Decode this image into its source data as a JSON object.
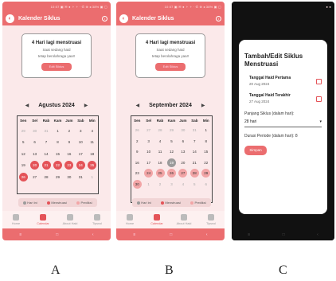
{
  "status_text": "10:07 ▣ ✉ ● ⚬ ⚬ · ✆ ⊕ ◂ 38% ▣ ▢",
  "app_title": "Kalender Siklus",
  "card": {
    "heading": "4 Hari lagi menstruasi",
    "sub1": "Saat sedang haid",
    "sub2": "tetap berolahraga yaa!!",
    "button": "Edit Siklus"
  },
  "day_headers": [
    "Sen",
    "Sel",
    "Rab",
    "Kam",
    "Jum",
    "Sab",
    "Min"
  ],
  "screens": [
    {
      "month": "Agustus 2024",
      "weeks": [
        [
          [
            "29",
            "o"
          ],
          [
            "30",
            "o"
          ],
          [
            "31",
            "o"
          ],
          [
            "1",
            ""
          ],
          [
            "2",
            ""
          ],
          [
            "3",
            ""
          ],
          [
            "4",
            ""
          ]
        ],
        [
          [
            "5",
            ""
          ],
          [
            "6",
            ""
          ],
          [
            "7",
            ""
          ],
          [
            "8",
            ""
          ],
          [
            "9",
            ""
          ],
          [
            "10",
            ""
          ],
          [
            "11",
            ""
          ]
        ],
        [
          [
            "12",
            ""
          ],
          [
            "13",
            ""
          ],
          [
            "14",
            ""
          ],
          [
            "15",
            ""
          ],
          [
            "16",
            ""
          ],
          [
            "17",
            ""
          ],
          [
            "18",
            ""
          ]
        ],
        [
          [
            "19",
            ""
          ],
          [
            "20",
            "m"
          ],
          [
            "21",
            "m"
          ],
          [
            "22",
            "m"
          ],
          [
            "23",
            "m"
          ],
          [
            "24",
            "m"
          ],
          [
            "25",
            "m"
          ]
        ],
        [
          [
            "26",
            "m"
          ],
          [
            "27",
            ""
          ],
          [
            "28",
            ""
          ],
          [
            "29",
            ""
          ],
          [
            "30",
            ""
          ],
          [
            "31",
            ""
          ],
          [
            "1",
            "o"
          ]
        ]
      ]
    },
    {
      "month": "September 2024",
      "weeks": [
        [
          [
            "26",
            "o"
          ],
          [
            "27",
            "o"
          ],
          [
            "28",
            "o"
          ],
          [
            "29",
            "o"
          ],
          [
            "30",
            "o"
          ],
          [
            "31",
            "o"
          ],
          [
            "1",
            ""
          ]
        ],
        [
          [
            "2",
            ""
          ],
          [
            "3",
            ""
          ],
          [
            "4",
            ""
          ],
          [
            "5",
            ""
          ],
          [
            "6",
            ""
          ],
          [
            "7",
            ""
          ],
          [
            "8",
            ""
          ]
        ],
        [
          [
            "9",
            ""
          ],
          [
            "10",
            ""
          ],
          [
            "11",
            ""
          ],
          [
            "12",
            ""
          ],
          [
            "13",
            ""
          ],
          [
            "14",
            ""
          ],
          [
            "15",
            ""
          ]
        ],
        [
          [
            "16",
            ""
          ],
          [
            "17",
            ""
          ],
          [
            "18",
            ""
          ],
          [
            "19",
            "t"
          ],
          [
            "20",
            ""
          ],
          [
            "21",
            ""
          ],
          [
            "22",
            ""
          ]
        ],
        [
          [
            "23",
            ""
          ],
          [
            "24",
            "f"
          ],
          [
            "25",
            "f"
          ],
          [
            "26",
            "f"
          ],
          [
            "27",
            "f"
          ],
          [
            "28",
            "f"
          ],
          [
            "29",
            "f"
          ]
        ],
        [
          [
            "30",
            "f"
          ],
          [
            "1",
            "o"
          ],
          [
            "2",
            "o"
          ],
          [
            "3",
            "o"
          ],
          [
            "4",
            "o"
          ],
          [
            "5",
            "o"
          ],
          [
            "6",
            "o"
          ]
        ]
      ]
    }
  ],
  "legend": [
    {
      "label": "Hari ini",
      "color": "#9b9b9b"
    },
    {
      "label": "Menstruasi",
      "color": "#e45358"
    },
    {
      "label": "Prediksi",
      "color": "#f2a5a6"
    }
  ],
  "nav": [
    {
      "label": "Home",
      "active": false
    },
    {
      "label": "Calendar",
      "active": true
    },
    {
      "label": "About Haid",
      "active": false
    },
    {
      "label": "Tipsnol",
      "active": false
    }
  ],
  "sysbar": [
    "≡",
    "□",
    "‹"
  ],
  "dialog": {
    "title": "Tambah/Edit Siklus Menstruasi",
    "first_label": "Tanggal Haid Pertama",
    "first_value": "20 Aug 2024",
    "last_label": "Tanggal Haid Terakhir",
    "last_value": "27 Aug 2024",
    "length_label": "Panjang Siklus (dalam hari):",
    "length_value": "28 hari",
    "duration": "Durasi Periode (dalam hari): 8",
    "save": "Simpan"
  },
  "captions": [
    "A",
    "B",
    "C"
  ]
}
